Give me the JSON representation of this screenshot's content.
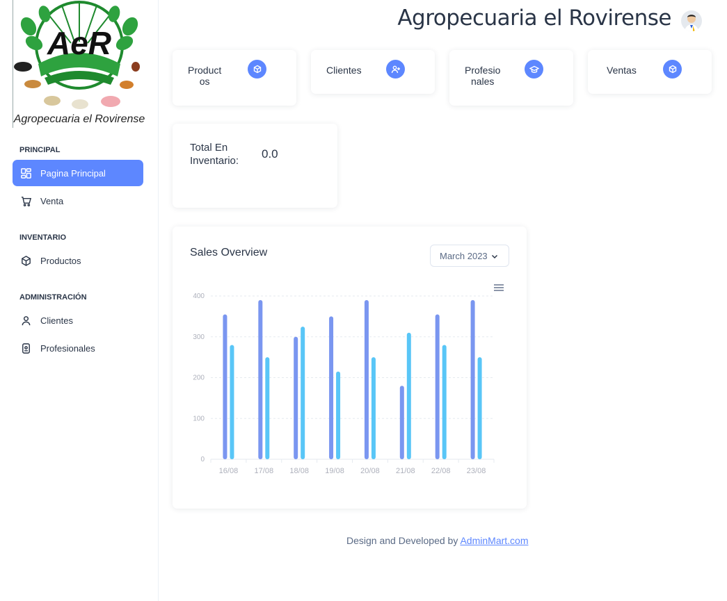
{
  "brand": {
    "logo_text": "Agropecuaria el Rovirense",
    "logo_monogram": "AeR",
    "title": "Agropecuaria el Rovirense"
  },
  "sidebar": {
    "sections": [
      {
        "heading": "PRINCIPAL",
        "items": [
          {
            "label": "Pagina Principal",
            "icon": "dashboard-icon",
            "active": true
          },
          {
            "label": "Venta",
            "icon": "cart-icon"
          }
        ]
      },
      {
        "heading": "INVENTARIO",
        "items": [
          {
            "label": "Productos",
            "icon": "box-icon"
          }
        ]
      },
      {
        "heading": "ADMINISTRACIÓN",
        "items": [
          {
            "label": "Clientes",
            "icon": "user-icon"
          },
          {
            "label": "Profesionales",
            "icon": "id-badge-icon"
          }
        ]
      }
    ]
  },
  "stats": [
    {
      "label_line1": "Product",
      "label_line2": "os",
      "icon": "cube-icon"
    },
    {
      "label_line1": "Clientes",
      "label_line2": "",
      "icon": "user-plus-icon"
    },
    {
      "label_line1": "Profesio",
      "label_line2": "nales",
      "icon": "graduation-cap-icon"
    },
    {
      "label_line1": "Ventas",
      "label_line2": "",
      "icon": "cube-icon"
    }
  ],
  "inventory": {
    "label_line1": "Total En",
    "label_line2": "Inventario:",
    "value": "0.0"
  },
  "sales": {
    "title": "Sales Overview",
    "month": "March 2023"
  },
  "chart_data": {
    "type": "bar",
    "categories": [
      "16/08",
      "17/08",
      "18/08",
      "19/08",
      "20/08",
      "21/08",
      "22/08",
      "23/08"
    ],
    "series": [
      {
        "values": [
          355,
          390,
          300,
          350,
          390,
          180,
          355,
          390
        ]
      },
      {
        "values": [
          280,
          250,
          325,
          215,
          250,
          310,
          280,
          250
        ]
      }
    ],
    "yticks": [
      0,
      100,
      200,
      300,
      400
    ],
    "ylim": [
      0,
      400
    ],
    "grid": true,
    "colors": [
      "#7a96f0",
      "#59c6f7"
    ]
  },
  "footer": {
    "text": "Design and Developed by",
    "link": "AdminMart.com"
  },
  "colors": {
    "primary": "#5d87ff",
    "text": "#2a3547"
  }
}
